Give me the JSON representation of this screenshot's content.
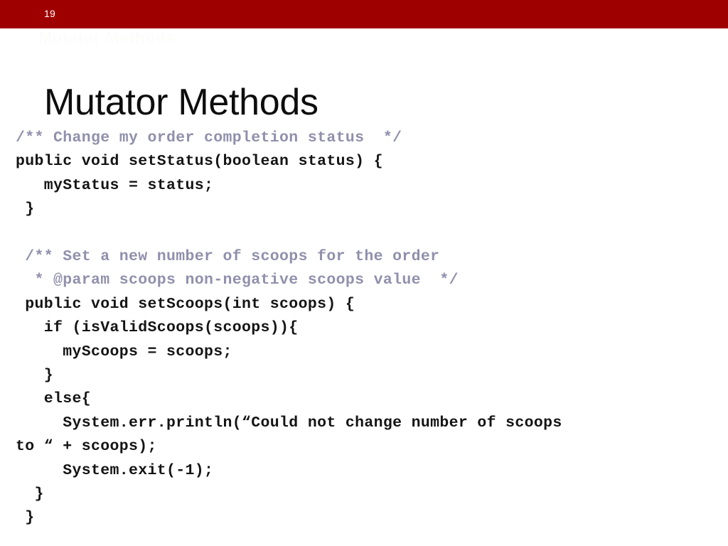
{
  "slide": {
    "number": "19",
    "title": "Mutator Methods",
    "watermark": "Mutator Methods",
    "banner_color": "#9e0000",
    "background_color": "#ffffff",
    "title_color": "#0d0d0d",
    "code_color": "#141414",
    "comment_color": "#9090ac"
  },
  "code": {
    "language": "java",
    "lines": [
      {
        "text": "/** Change my order completion status  */",
        "kind": "comment"
      },
      {
        "text": "public void setStatus(boolean status) {",
        "kind": "code"
      },
      {
        "text": "   myStatus = status;",
        "kind": "code"
      },
      {
        "text": " }",
        "kind": "code"
      },
      {
        "text": "",
        "kind": "blank"
      },
      {
        "text": " /** Set a new number of scoops for the order",
        "kind": "comment"
      },
      {
        "text": "  * @param scoops non-negative scoops value  */",
        "kind": "comment"
      },
      {
        "text": " public void setScoops(int scoops) {",
        "kind": "code"
      },
      {
        "text": "   if (isValidScoops(scoops)){",
        "kind": "code"
      },
      {
        "text": "     myScoops = scoops;",
        "kind": "code"
      },
      {
        "text": "   }",
        "kind": "code"
      },
      {
        "text": "   else{",
        "kind": "code"
      },
      {
        "text": "     System.err.println(“Could not change number of scoops",
        "kind": "code"
      },
      {
        "text": "to “ + scoops);",
        "kind": "code"
      },
      {
        "text": "     System.exit(-1);",
        "kind": "code"
      },
      {
        "text": "  }",
        "kind": "code"
      },
      {
        "text": " }",
        "kind": "code"
      }
    ]
  }
}
